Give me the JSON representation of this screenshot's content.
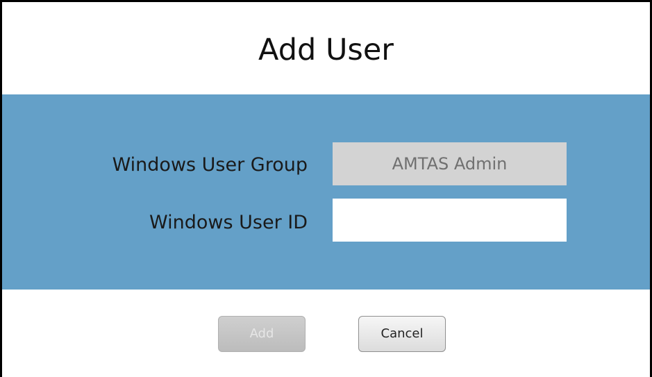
{
  "dialog": {
    "title": "Add User"
  },
  "form": {
    "group_label": "Windows User Group",
    "group_value": "AMTAS Admin",
    "user_id_label": "Windows User ID",
    "user_id_value": "",
    "user_id_placeholder": ""
  },
  "buttons": {
    "add_label": "Add",
    "cancel_label": "Cancel"
  },
  "colors": {
    "band": "#64a0c8",
    "readonly_field": "#d3d3d3"
  }
}
